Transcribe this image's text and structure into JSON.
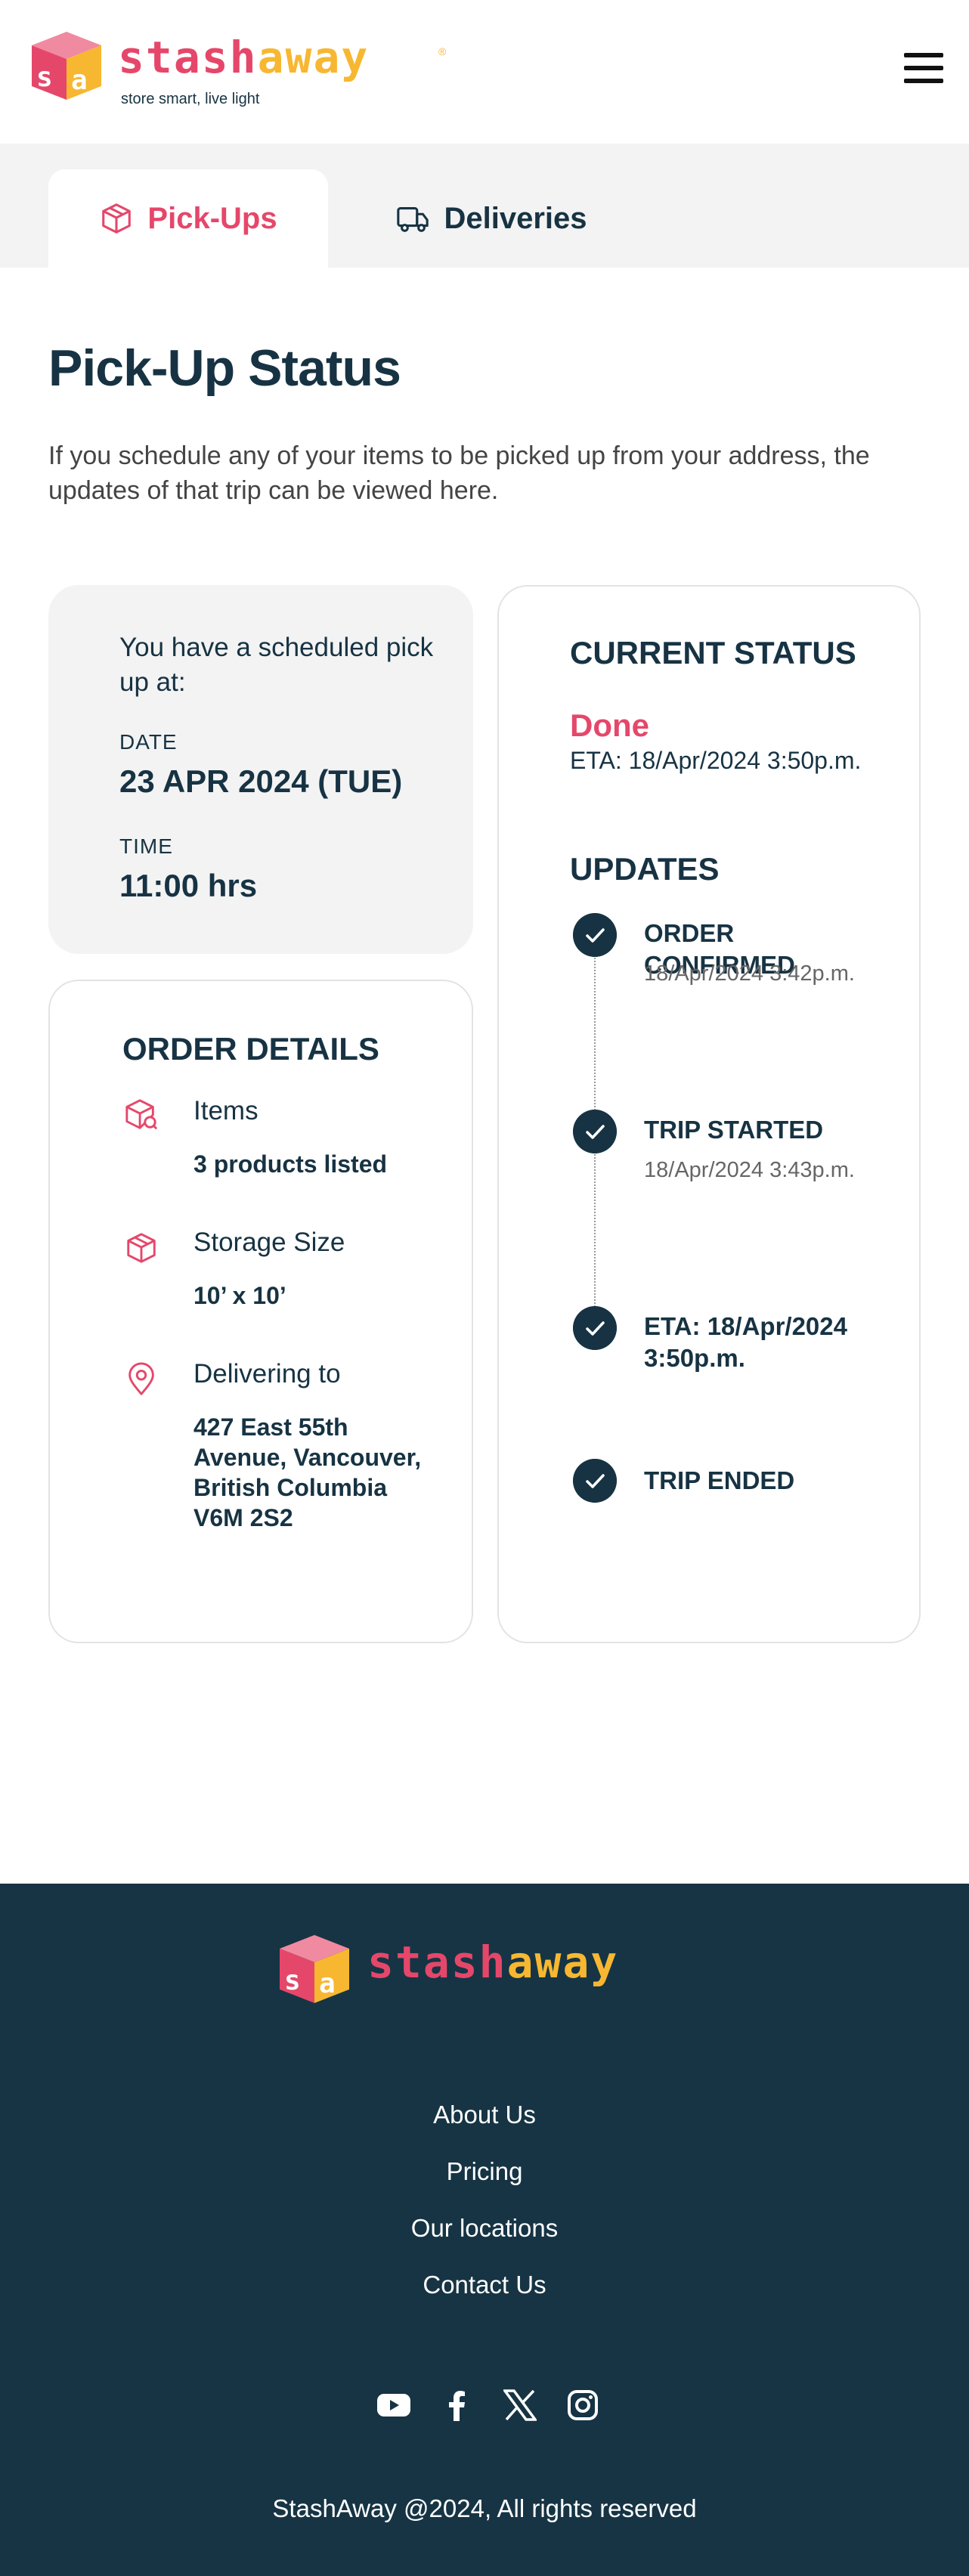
{
  "brand": {
    "name_part1": "stash",
    "name_part2": "away",
    "registered": "®",
    "tagline": "store smart, live light",
    "colors": {
      "primary_pink": "#e5476a",
      "accent_yellow": "#f7b731",
      "navy": "#173343",
      "footer_bg": "#163444"
    }
  },
  "header": {
    "menu_icon": "hamburger-menu-icon"
  },
  "tabs": [
    {
      "label": "Pick-Ups",
      "icon": "box-icon",
      "active": true
    },
    {
      "label": "Deliveries",
      "icon": "truck-icon",
      "active": false
    }
  ],
  "page": {
    "title": "Pick-Up Status",
    "description": "If you schedule any of your items to be picked up from your address, the updates of that trip can be viewed here."
  },
  "schedule": {
    "intro": "You have a scheduled pick up at:",
    "date_label": "DATE",
    "date_value": "23 APR 2024 (TUE)",
    "time_label": "TIME",
    "time_value": "11:00 hrs"
  },
  "order_details": {
    "heading": "ORDER DETAILS",
    "items_label": "Items",
    "items_value": "3 products listed",
    "storage_label": "Storage Size",
    "storage_value": "10’ x 10’",
    "delivering_label": "Delivering to",
    "delivering_value": "427 East 55th Avenue, Vancouver, British Columbia V6M 2S2"
  },
  "status": {
    "heading": "CURRENT STATUS",
    "state": "Done",
    "eta": "ETA: 18/Apr/2024 3:50p.m.",
    "updates_heading": "UPDATES",
    "updates": [
      {
        "title": "ORDER CONFIRMED",
        "time": "18/Apr/2024 3:42p.m."
      },
      {
        "title": "TRIP STARTED",
        "time": "18/Apr/2024 3:43p.m."
      },
      {
        "title": "ETA: 18/Apr/2024 3:50p.m.",
        "time": ""
      },
      {
        "title": "TRIP ENDED",
        "time": ""
      }
    ]
  },
  "footer": {
    "links": [
      "About Us",
      "Pricing",
      "Our locations",
      "Contact Us"
    ],
    "socials": [
      "youtube-icon",
      "facebook-icon",
      "x-icon",
      "instagram-icon"
    ],
    "copyright": "StashAway @2024, All rights reserved"
  }
}
